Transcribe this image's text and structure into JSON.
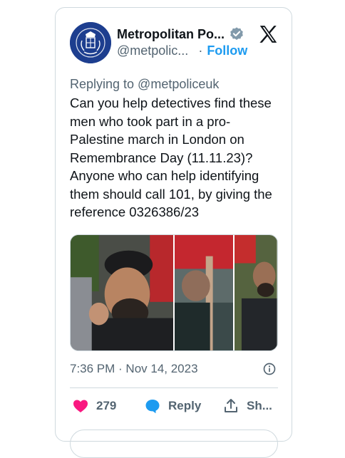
{
  "account": {
    "name": "Metropolitan Po...",
    "handle": "@metpolic...",
    "separator": "·",
    "follow_label": "Follow"
  },
  "tweet": {
    "replying_to": "Replying to @metpoliceuk",
    "text": "Can you help detectives find these men who took part in a pro-Palestine march in London on Remembrance Day (11.11.23)? Anyone who can help identifying them should call 101, by giving the reference 0326386/23",
    "timestamp": "7:36 PM · Nov 14, 2023"
  },
  "actions": {
    "likes_count": "279",
    "reply_label": "Reply",
    "share_label": "Sh..."
  },
  "colors": {
    "link_blue": "#1d9bf0",
    "like_red": "#f91880",
    "muted_text": "#536471",
    "border": "#cfd9de",
    "avatar_bg": "#1d3e8f"
  },
  "icons": [
    "crest-icon",
    "verified-badge-icon",
    "x-logo-icon",
    "info-icon",
    "heart-icon",
    "reply-bubble-icon",
    "share-icon"
  ]
}
